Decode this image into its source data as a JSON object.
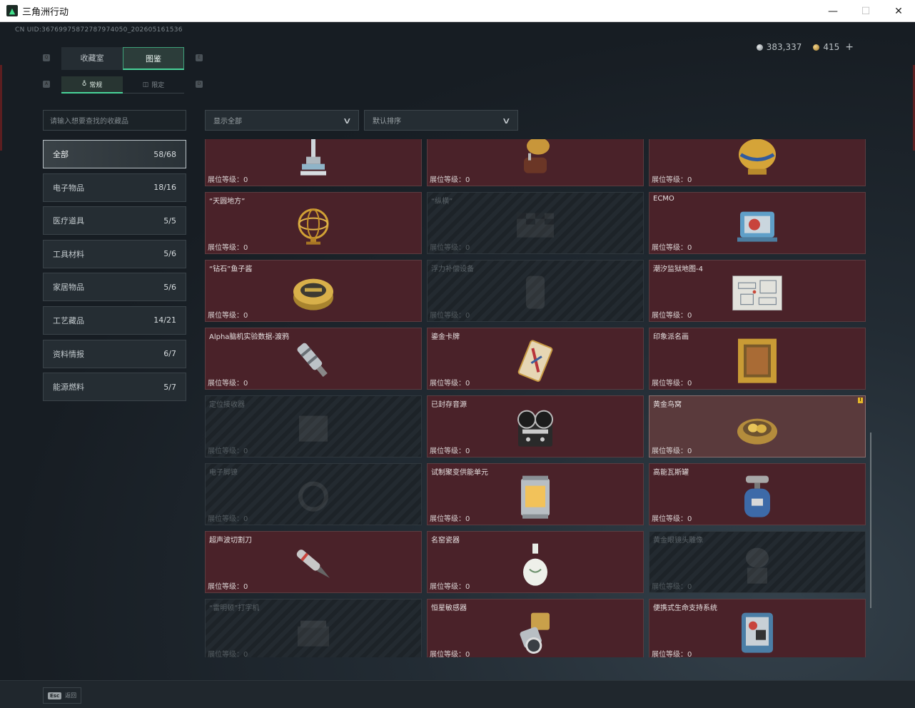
{
  "window": {
    "title": "三角洲行动",
    "minimize": "—",
    "maximize": "☐",
    "close": "✕"
  },
  "uid": "CN UID:36769975872787974050_202605161536",
  "currency": {
    "silver": "383,337",
    "gold": "415",
    "plus": "+"
  },
  "key_hints": {
    "main_left": "Q",
    "main_right": "E",
    "sub_left": "A",
    "sub_right": "D"
  },
  "tabs": {
    "main": [
      "收藏室",
      "图鉴"
    ],
    "active_main": 1,
    "sub": [
      "常规",
      "限定"
    ],
    "active_sub": 0
  },
  "search": {
    "placeholder": "请输入想要查找的收藏品"
  },
  "filters": {
    "show": "显示全部",
    "sort": "默认排序"
  },
  "categories": [
    {
      "label": "全部",
      "count": "58/68",
      "active": true
    },
    {
      "label": "电子物品",
      "count": "18/16"
    },
    {
      "label": "医疗道具",
      "count": "5/5"
    },
    {
      "label": "工具材料",
      "count": "5/6"
    },
    {
      "label": "家居物品",
      "count": "5/6"
    },
    {
      "label": "工艺藏品",
      "count": "14/21"
    },
    {
      "label": "资料情报",
      "count": "6/7"
    },
    {
      "label": "能源燃料",
      "count": "5/7"
    }
  ],
  "level_label": "展位等级：0",
  "items": [
    {
      "name": "",
      "icon": "robot-arm",
      "locked": false
    },
    {
      "name": "",
      "icon": "gramophone",
      "locked": false
    },
    {
      "name": "",
      "icon": "golden-egg",
      "locked": false
    },
    {
      "name": "“天圆地方”",
      "icon": "armillary-sphere",
      "locked": false
    },
    {
      "name": "“纵横”",
      "icon": "chessboard",
      "locked": true
    },
    {
      "name": "ECMO",
      "icon": "ecmo-machine",
      "locked": false
    },
    {
      "name": "“钻石”鱼子酱",
      "icon": "caviar-tin",
      "locked": false
    },
    {
      "name": "浮力补偿设备",
      "icon": "buoyancy-device",
      "locked": true
    },
    {
      "name": "潮汐监狱地图-4",
      "icon": "prison-map",
      "locked": false
    },
    {
      "name": "Alpha脑机实验数据-渡鸦",
      "icon": "data-canister",
      "locked": false
    },
    {
      "name": "鎏金卡牌",
      "icon": "gilded-card",
      "locked": false
    },
    {
      "name": "印象派名画",
      "icon": "framed-painting",
      "locked": false
    },
    {
      "name": "定位接收器",
      "icon": "gps-receiver",
      "locked": true
    },
    {
      "name": "已封存音源",
      "icon": "reel-recorder",
      "locked": false
    },
    {
      "name": "黄金鸟窝",
      "icon": "golden-nest",
      "locked": false,
      "highlight": true,
      "badge": "!"
    },
    {
      "name": "电子脚镣",
      "icon": "ankle-monitor",
      "locked": true
    },
    {
      "name": "试制聚变供能单元",
      "icon": "fusion-unit",
      "locked": false
    },
    {
      "name": "高能瓦斯罐",
      "icon": "gas-canister",
      "locked": false
    },
    {
      "name": "超声波切割刀",
      "icon": "ultrasonic-cutter",
      "locked": false
    },
    {
      "name": "名窑瓷器",
      "icon": "porcelain-vase",
      "locked": false
    },
    {
      "name": "黄金眼镜头雕像",
      "icon": "golden-statue",
      "locked": true
    },
    {
      "name": "“雷明顿”打字机",
      "icon": "typewriter",
      "locked": true
    },
    {
      "name": "恒星敏感器",
      "icon": "star-sensor",
      "locked": false
    },
    {
      "name": "便携式生命支持系统",
      "icon": "life-support",
      "locked": false
    }
  ],
  "footer": {
    "esc_key": "Esc",
    "esc_label": "返回"
  },
  "colors": {
    "accent": "#49d59a",
    "card_bg": "#4a2229",
    "locked_bg": "#232a30",
    "badge": "#e6b82a"
  }
}
